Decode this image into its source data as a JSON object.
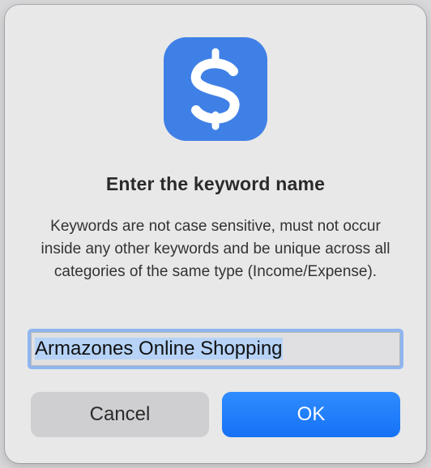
{
  "dialog": {
    "title": "Enter the keyword name",
    "message": "Keywords are not case sensitive, must not occur inside any other keywords and be unique across all categories of the same type (Income/Expense).",
    "app_icon": "dollar-sign-app-icon",
    "keyword_input": {
      "value": "Armazones Online Shopping",
      "selected": true
    },
    "buttons": {
      "cancel_label": "Cancel",
      "ok_label": "OK"
    }
  },
  "colors": {
    "accent": "#1672f5",
    "icon_background": "#3f80e6",
    "selection": "#b6d3f7"
  }
}
